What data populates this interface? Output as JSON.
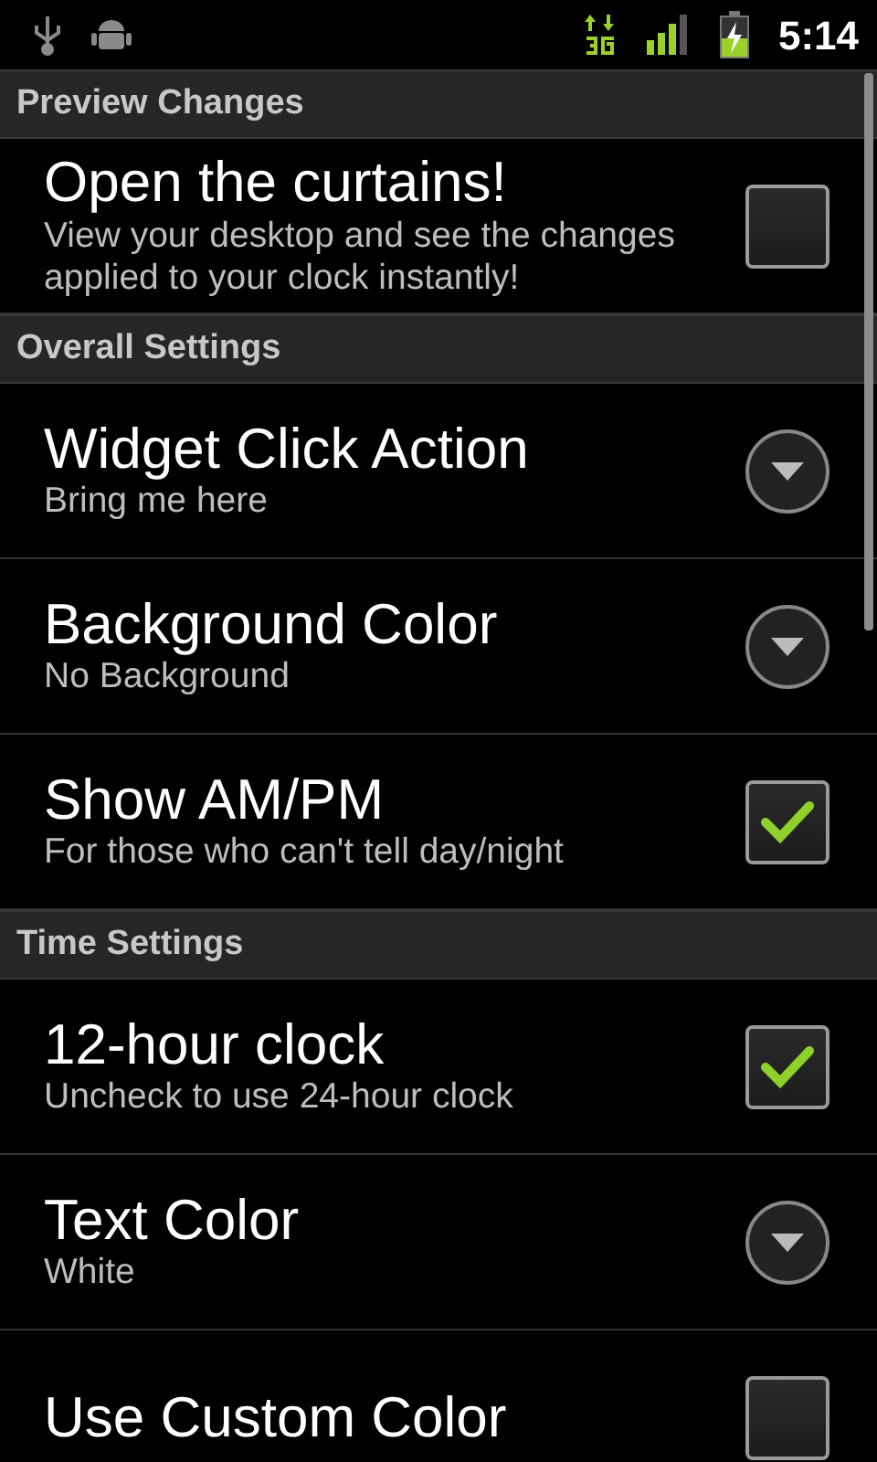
{
  "status_bar": {
    "time": "5:14"
  },
  "sections": [
    {
      "header": "Preview Changes",
      "items": [
        {
          "kind": "checkbox",
          "title": "Open the curtains!",
          "summary": "View your desktop and see the changes applied to your clock instantly!",
          "checked": false
        }
      ]
    },
    {
      "header": "Overall Settings",
      "items": [
        {
          "kind": "dropdown",
          "title": "Widget Click Action",
          "summary": "Bring me here"
        },
        {
          "kind": "dropdown",
          "title": "Background Color",
          "summary": "No Background"
        },
        {
          "kind": "checkbox",
          "title": "Show AM/PM",
          "summary": "For those who can't tell day/night",
          "checked": true
        }
      ]
    },
    {
      "header": "Time Settings",
      "items": [
        {
          "kind": "checkbox",
          "title": "12-hour clock",
          "summary": "Uncheck to use 24-hour clock",
          "checked": true
        },
        {
          "kind": "dropdown",
          "title": "Text Color",
          "summary": "White"
        },
        {
          "kind": "checkbox",
          "title": "Use Custom Color",
          "checked": false
        }
      ]
    }
  ]
}
